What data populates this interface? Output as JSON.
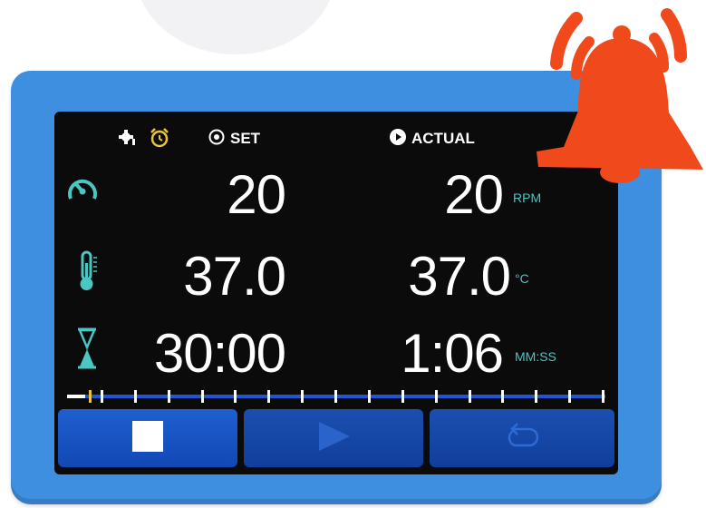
{
  "header": {
    "set_label": "SET",
    "actual_label": "ACTUAL"
  },
  "rows": [
    {
      "name": "speed",
      "icon": "speedometer-icon",
      "set": "20",
      "actual": "20",
      "unit": "RPM"
    },
    {
      "name": "temperature",
      "icon": "thermometer-icon",
      "set": "37.0",
      "actual": "37.0",
      "unit": "°C"
    },
    {
      "name": "time",
      "icon": "hourglass-icon",
      "set": "30:00",
      "actual": "1:06",
      "unit": "MM:SS"
    }
  ],
  "progress": {
    "fraction": 0.04
  },
  "buttons": [
    {
      "name": "stop-button",
      "icon": "stop-icon"
    },
    {
      "name": "play-button",
      "icon": "play-icon"
    },
    {
      "name": "reset-button",
      "icon": "reset-icon"
    }
  ],
  "colors": {
    "frame": "#3f8fe0",
    "accent_cyan": "#4ac6c3",
    "button_blue": "#1e5fd0",
    "alarm": "#f04a1c"
  }
}
